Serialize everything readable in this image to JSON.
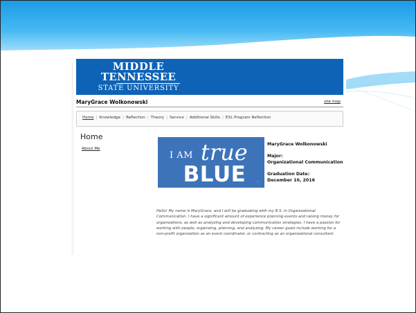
{
  "site": {
    "university_line1": "MIDDLE",
    "university_line2": "TENNESSEE",
    "university_line3": "STATE UNIVERSITY",
    "owner_name": "MaryGrace Wolkonowski",
    "site_map_label": "site map"
  },
  "nav": {
    "items": [
      {
        "label": "Home",
        "active": true
      },
      {
        "label": "Knowledge"
      },
      {
        "label": "Reflection"
      },
      {
        "label": "Theory"
      },
      {
        "label": "Service"
      },
      {
        "label": "Additional Skills"
      },
      {
        "label": "EXL Program Reflection"
      }
    ]
  },
  "page": {
    "title": "Home",
    "subnav_label": "About Me"
  },
  "logo": {
    "text_iam": "I AM",
    "text_true": "true",
    "text_blue": "BLUE",
    "tm": "™"
  },
  "profile": {
    "name": "MaryGrace Wolkonowski",
    "major_label": "Major:",
    "major_value": "Organizational Communication",
    "graduation_label": "Graduation Date:",
    "graduation_value": "December 10, 2016"
  },
  "bio": "Hello! My name is MaryGrace, and I will be graduating with my B.S. in Organizational Communication. I have a significant amount of experience planning events and raising money for organizations, as well as analyzing and developing communication strategies. I have a passion for working with people, organizing, planning, and analyzing. My career goals include working for a non-profit organization as an event coordinator, or contracting as an organizational consultant.",
  "colors": {
    "mtsu_blue": "#0e63b6",
    "true_blue": "#3d73b9",
    "slide_sky": "#2aa9ee"
  }
}
